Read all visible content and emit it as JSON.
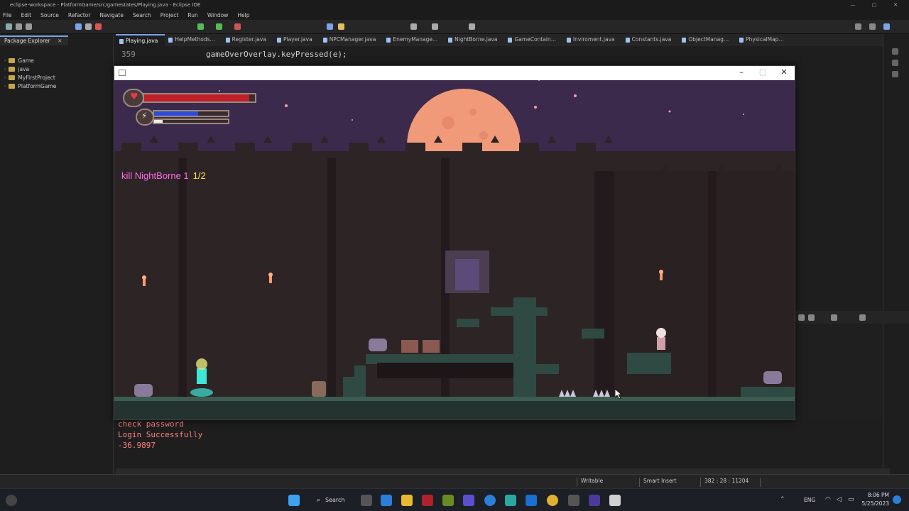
{
  "window": {
    "title": "eclipse-workspace - PlatformGame/src/gamestates/Playing.java - Eclipse IDE"
  },
  "menu": [
    "File",
    "Edit",
    "Source",
    "Refactor",
    "Navigate",
    "Search",
    "Project",
    "Run",
    "Window",
    "Help"
  ],
  "package_explorer": {
    "tab_label": "Package Explorer",
    "items": [
      "Game",
      "java",
      "MyFirstProject",
      "PlatformGame"
    ]
  },
  "editor_tabs": [
    "Playing.java",
    "HelpMethods...",
    "Register.java",
    "Player.java",
    "NPCManager.java",
    "EnemyManage...",
    "NightBorne.java",
    "GameContain...",
    "Inviroment.java",
    "Constants.java",
    "ObjectManag...",
    "PhysicalMap..."
  ],
  "editor": {
    "lines": [
      {
        "num": "359",
        "text": "gameOverOverlay.keyPressed(e);"
      }
    ]
  },
  "console": {
    "lines": [
      "check password",
      "Login Successfully",
      "-36.9897"
    ]
  },
  "statusbar": {
    "mode": "Writable",
    "insert": "Smart Insert",
    "position": "382 : 28 : 11204"
  },
  "taskbar": {
    "search_label": "Search",
    "lang": "ENG",
    "time": "8:06 PM",
    "date": "5/25/2023"
  },
  "game": {
    "objective_text": "kill NightBorne 1",
    "objective_count": "1/2",
    "health_fraction": 0.95,
    "energy_fraction": 0.6
  },
  "colors": {
    "sky": "#3c2a4c",
    "moon": "#f09a7a",
    "wall": "#2d2426",
    "floor": "#2f4a42",
    "objective": "#ff6de8",
    "count": "#ffe14d"
  }
}
